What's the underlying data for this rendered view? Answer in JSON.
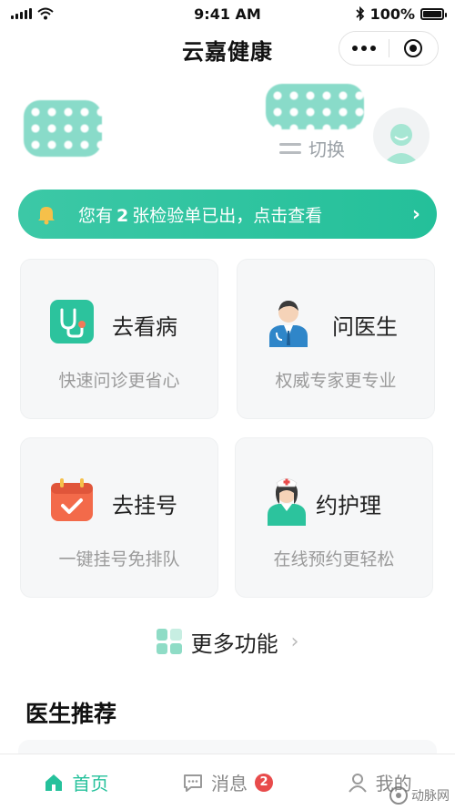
{
  "status_bar": {
    "time": "9:41 AM",
    "battery": "100%",
    "battery_level": 1.0
  },
  "nav": {
    "title": "云嘉健康"
  },
  "profile": {
    "switch_label": "切换"
  },
  "banner": {
    "prefix": "您有",
    "count": "2",
    "suffix": "张检验单已出，点击查看"
  },
  "cards": [
    {
      "title": "去看病",
      "subtitle": "快速问诊更省心",
      "icon": "stethoscope-icon"
    },
    {
      "title": "问医生",
      "subtitle": "权威专家更专业",
      "icon": "doctor-icon"
    },
    {
      "title": "去挂号",
      "subtitle": "一键挂号免排队",
      "icon": "calendar-check-icon"
    },
    {
      "title": "约护理",
      "subtitle": "在线预约更轻松",
      "icon": "nurse-icon"
    }
  ],
  "more": {
    "label": "更多功能"
  },
  "section": {
    "title": "医生推荐"
  },
  "tabs": [
    {
      "label": "首页",
      "icon": "home-icon",
      "active": true
    },
    {
      "label": "消息",
      "icon": "message-icon",
      "badge": "2"
    },
    {
      "label": "我的",
      "icon": "user-icon"
    }
  ],
  "watermark": {
    "text": "动脉网"
  },
  "colors": {
    "accent": "#25c19b",
    "badge": "#e84b4b",
    "card_bg": "#f6f7f8"
  }
}
